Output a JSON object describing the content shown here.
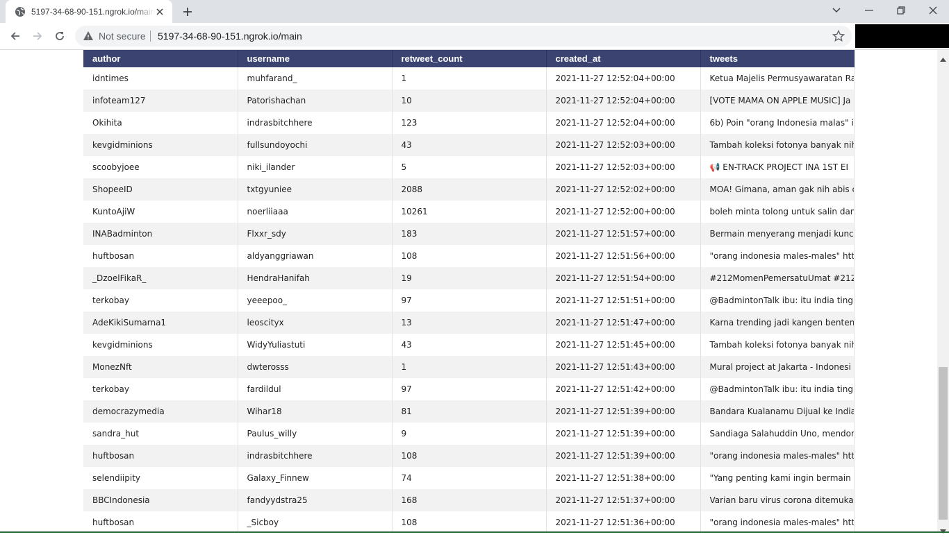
{
  "browser": {
    "tab_title": "5197-34-68-90-151.ngrok.io/main",
    "security_label": "Not secure",
    "url": "5197-34-68-90-151.ngrok.io/main"
  },
  "table": {
    "columns": [
      "author",
      "username",
      "retweet_count",
      "created_at",
      "tweets"
    ],
    "rows": [
      [
        "idntimes",
        "muhfarand_",
        "1",
        "2021-11-27 12:52:04+00:00",
        "Ketua Majelis Permusyawaratan Ra"
      ],
      [
        "infoteam127",
        "Patorishachan",
        "10",
        "2021-11-27 12:52:04+00:00",
        "[VOTE MAMA ON APPLE MUSIC]  Ja"
      ],
      [
        "Okihita",
        "indrasbitchhere",
        "123",
        "2021-11-27 12:52:04+00:00",
        "6b) Poin \"orang Indonesia malas\" i"
      ],
      [
        "kevgidminions",
        "fullsundoyochi",
        "43",
        "2021-11-27 12:52:03+00:00",
        "Tambah koleksi fotonya banyak nih"
      ],
      [
        "scoobyjoee",
        "niki_ilander",
        "5",
        "2021-11-27 12:52:03+00:00",
        "📢 EN-TRACK PROJECT INA 1ST EI"
      ],
      [
        "ShopeeID",
        "txtgyuniee",
        "2088",
        "2021-11-27 12:52:02+00:00",
        "MOA! Gimana, aman gak nih abis c"
      ],
      [
        "KuntoAjiW",
        "noerliiaaa",
        "10261",
        "2021-11-27 12:52:00+00:00",
        "boleh minta tolong untuk salin dan"
      ],
      [
        "INABadminton",
        "Flxxr_sdy",
        "183",
        "2021-11-27 12:51:57+00:00",
        "Bermain menyerang menjadi kunci"
      ],
      [
        "huftbosan",
        "aldyanggriawan",
        "108",
        "2021-11-27 12:51:56+00:00",
        "\"orang indonesia males-males\" htt"
      ],
      [
        "_DzoelFikaR_",
        "HendraHanifah",
        "19",
        "2021-11-27 12:51:54+00:00",
        "#212MomenPemersatuUmat #212"
      ],
      [
        "terkobay",
        "yeeepoo_",
        "97",
        "2021-11-27 12:51:51+00:00",
        "@BadmintonTalk ibu: itu india ting"
      ],
      [
        "AdeKikiSumarna1",
        "leoscityx",
        "13",
        "2021-11-27 12:51:47+00:00",
        "Karna trending jadi kangen benten"
      ],
      [
        "kevgidminions",
        "WidyYuliastuti",
        "43",
        "2021-11-27 12:51:45+00:00",
        "Tambah koleksi fotonya banyak nih"
      ],
      [
        "MonezNft",
        "dwterosss",
        "1",
        "2021-11-27 12:51:43+00:00",
        "Mural project at Jakarta - Indonesi"
      ],
      [
        "terkobay",
        "fardildul",
        "97",
        "2021-11-27 12:51:42+00:00",
        "@BadmintonTalk ibu: itu india ting"
      ],
      [
        "democrazymedia",
        "Wihar18",
        "81",
        "2021-11-27 12:51:39+00:00",
        "Bandara Kualanamu Dijual ke India"
      ],
      [
        "sandra_hut",
        "Paulus_willy",
        "9",
        "2021-11-27 12:51:39+00:00",
        "Sandiaga Salahuddin Uno, mendor"
      ],
      [
        "huftbosan",
        "indrasbitchhere",
        "108",
        "2021-11-27 12:51:39+00:00",
        "\"orang indonesia males-males\" htt"
      ],
      [
        "selendiipity",
        "Galaxy_Finnew",
        "74",
        "2021-11-27 12:51:38+00:00",
        "\"Yang penting kami ingin bermain"
      ],
      [
        "BBCIndonesia",
        "fandyydstra25",
        "168",
        "2021-11-27 12:51:37+00:00",
        "Varian baru virus corona ditemuka"
      ],
      [
        "huftbosan",
        "_Sicboy",
        "108",
        "2021-11-27 12:51:36+00:00",
        "\"orang indonesia males-males\" htt"
      ]
    ]
  }
}
